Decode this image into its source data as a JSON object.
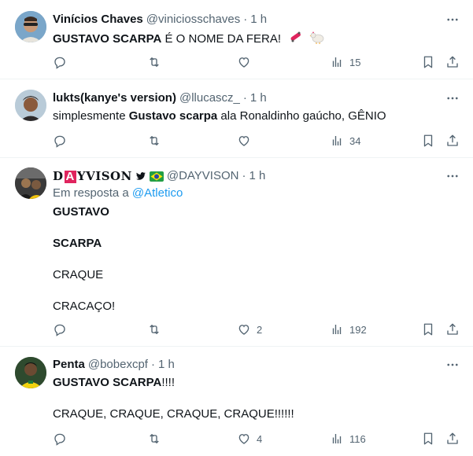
{
  "tweets": [
    {
      "name": "Vinícios Chaves",
      "handle": "@viniciosschaves",
      "time": "1 h",
      "text_bold": "GUSTAVO SCARPA",
      "text_rest": " É O NOME DA FERA!",
      "emojis": "🛹 🐔",
      "stats": {
        "replies": "",
        "retweets": "",
        "likes": "",
        "views": "15"
      }
    },
    {
      "name": "lukts(kanye's version)",
      "handle": "@llucascz_",
      "time": "1 h",
      "text_pre": "simplesmente ",
      "text_bold": "Gustavo scarpa",
      "text_rest": " ala Ronaldinho gaúcho, GÊNIO",
      "stats": {
        "replies": "",
        "retweets": "",
        "likes": "",
        "views": "34"
      }
    },
    {
      "name_parts": [
        "D",
        "A",
        "YVISON"
      ],
      "handle": "@DAYVISON",
      "time": "1 h",
      "reply_prefix": "Em resposta a",
      "reply_target": "@Atletico",
      "lines": [
        "GUSTAVO",
        "SCARPA",
        "CRAQUE",
        "CRACAÇO!"
      ],
      "stats": {
        "replies": "",
        "retweets": "",
        "likes": "2",
        "views": "192"
      }
    },
    {
      "name": "Penta",
      "handle": "@bobexcpf",
      "time": "1 h",
      "line1_bold": "GUSTAVO SCARPA",
      "line1_rest": "!!!!",
      "line2": "CRAQUE, CRAQUE, CRAQUE, CRAQUE!!!!!!",
      "stats": {
        "replies": "",
        "retweets": "",
        "likes": "4",
        "views": "116"
      }
    }
  ],
  "colors": {
    "text": "#0f1419",
    "muted": "#536471",
    "link": "#1d9bf0",
    "divider": "#eff3f4"
  }
}
